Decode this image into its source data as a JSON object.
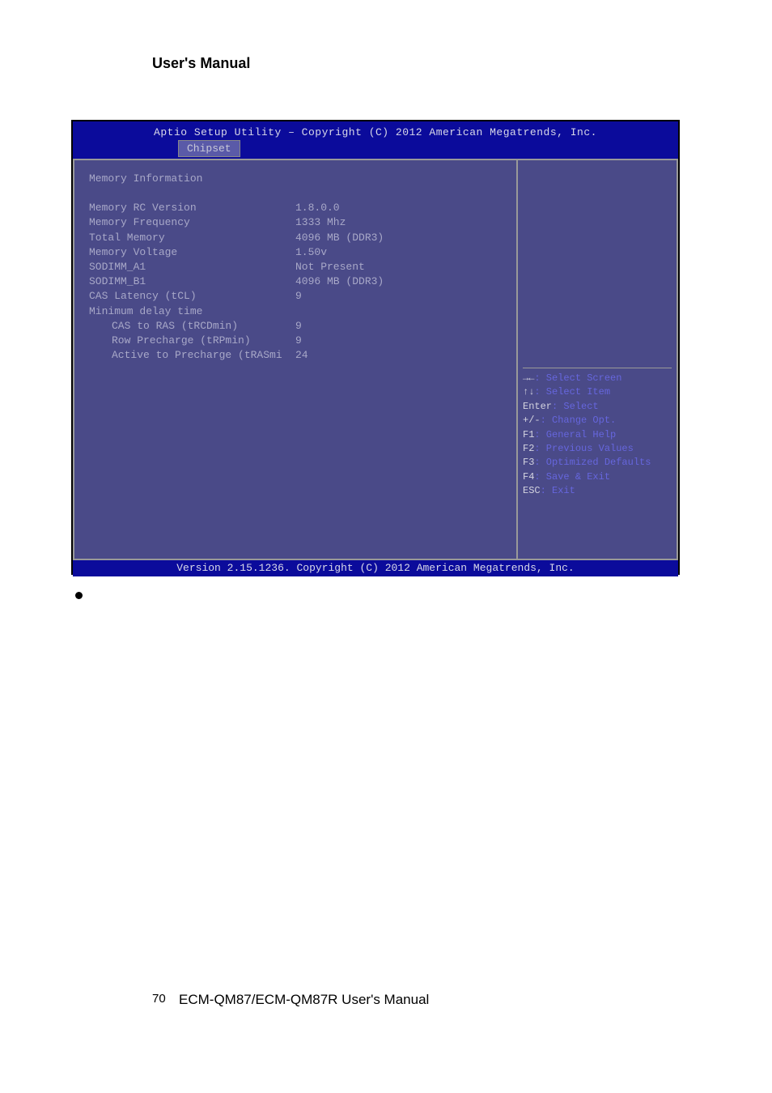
{
  "page": {
    "header": "User's Manual",
    "footer_num": "70",
    "footer_text": "ECM-QM87/ECM-QM87R User's Manual"
  },
  "bios": {
    "title": "Aptio Setup Utility – Copyright (C) 2012 American Megatrends, Inc.",
    "tab": "Chipset",
    "footer": "Version 2.15.1236. Copyright (C) 2012 American Megatrends, Inc.",
    "section_title": "Memory Information",
    "rows": [
      {
        "label": "Memory RC Version",
        "value": "1.8.0.0",
        "indent": false
      },
      {
        "label": "Memory Frequency",
        "value": "1333 Mhz",
        "indent": false
      },
      {
        "label": "Total Memory",
        "value": "4096 MB (DDR3)",
        "indent": false
      },
      {
        "label": "Memory Voltage",
        "value": "1.50v",
        "indent": false
      },
      {
        "label": "SODIMM_A1",
        "value": "Not Present",
        "indent": false
      },
      {
        "label": "SODIMM_B1",
        "value": "4096 MB (DDR3)",
        "indent": false
      },
      {
        "label": "CAS Latency (tCL)",
        "value": "9",
        "indent": false
      },
      {
        "label": "Minimum delay time",
        "value": "",
        "indent": false
      },
      {
        "label": "CAS to RAS (tRCDmin)",
        "value": "9",
        "indent": true
      },
      {
        "label": "Row Precharge (tRPmin)",
        "value": "9",
        "indent": true
      },
      {
        "label": "Active to Precharge (tRASmi",
        "value": "24",
        "indent": true
      }
    ],
    "help": [
      {
        "key": "→←",
        "text": ": Select Screen"
      },
      {
        "key": "↑↓",
        "text": ": Select Item"
      },
      {
        "key": "Enter",
        "text": ": Select"
      },
      {
        "key": "+/-",
        "text": ": Change Opt."
      },
      {
        "key": "F1",
        "text": ": General Help"
      },
      {
        "key": "F2",
        "text": ": Previous Values"
      },
      {
        "key": "F3",
        "text": ": Optimized Defaults"
      },
      {
        "key": "F4",
        "text": ": Save & Exit"
      },
      {
        "key": "ESC",
        "text": ": Exit"
      }
    ]
  }
}
